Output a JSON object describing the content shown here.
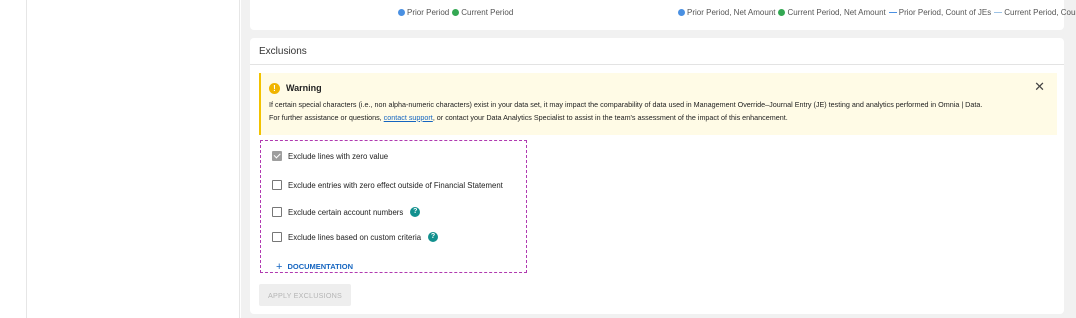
{
  "legend": {
    "left": [
      {
        "label": "Prior Period",
        "color": "#4a90e2",
        "kind": "dot"
      },
      {
        "label": "Current Period",
        "color": "#34a853",
        "kind": "dot"
      }
    ],
    "right": [
      {
        "label": "Prior Period, Net Amount",
        "color": "#4a90e2",
        "kind": "dot"
      },
      {
        "label": "Current Period, Net Amount",
        "color": "#34a853",
        "kind": "dot"
      },
      {
        "label": "Prior Period, Count of JEs",
        "color": "#4a90e2",
        "kind": "line"
      },
      {
        "label": "Current Period, Count of JEs",
        "color": "#9dc3e6",
        "kind": "line"
      }
    ]
  },
  "exclusions": {
    "title": "Exclusions",
    "warning": {
      "title": "Warning",
      "line1": "If certain special characters (i.e., non alpha-numeric characters) exist in your data set, it may impact the comparability of data used in Management Override–Journal Entry (JE) testing and analytics performed in Omnia | Data.",
      "line2_prefix": "For further assistance or questions, ",
      "link": "contact support",
      "line2_suffix": ", or contact your Data Analytics Specialist to assist in the team's assessment of the impact of this enhancement.",
      "close": "✕"
    },
    "options": [
      {
        "label": "Exclude lines with zero value",
        "checked": true,
        "info": false
      },
      {
        "label": "Exclude entries with zero effect outside of Financial Statement",
        "checked": false,
        "info": false
      },
      {
        "label": "Exclude certain account numbers",
        "checked": false,
        "info": true
      },
      {
        "label": "Exclude lines based on custom criteria",
        "checked": false,
        "info": true
      }
    ],
    "documentation_label": "DOCUMENTATION",
    "apply_label": "APPLY EXCLUSIONS"
  },
  "colors": {
    "accent": "#1565c0",
    "warning": "#f0b400",
    "info": "#12908e",
    "outline": "#b03ab0"
  }
}
